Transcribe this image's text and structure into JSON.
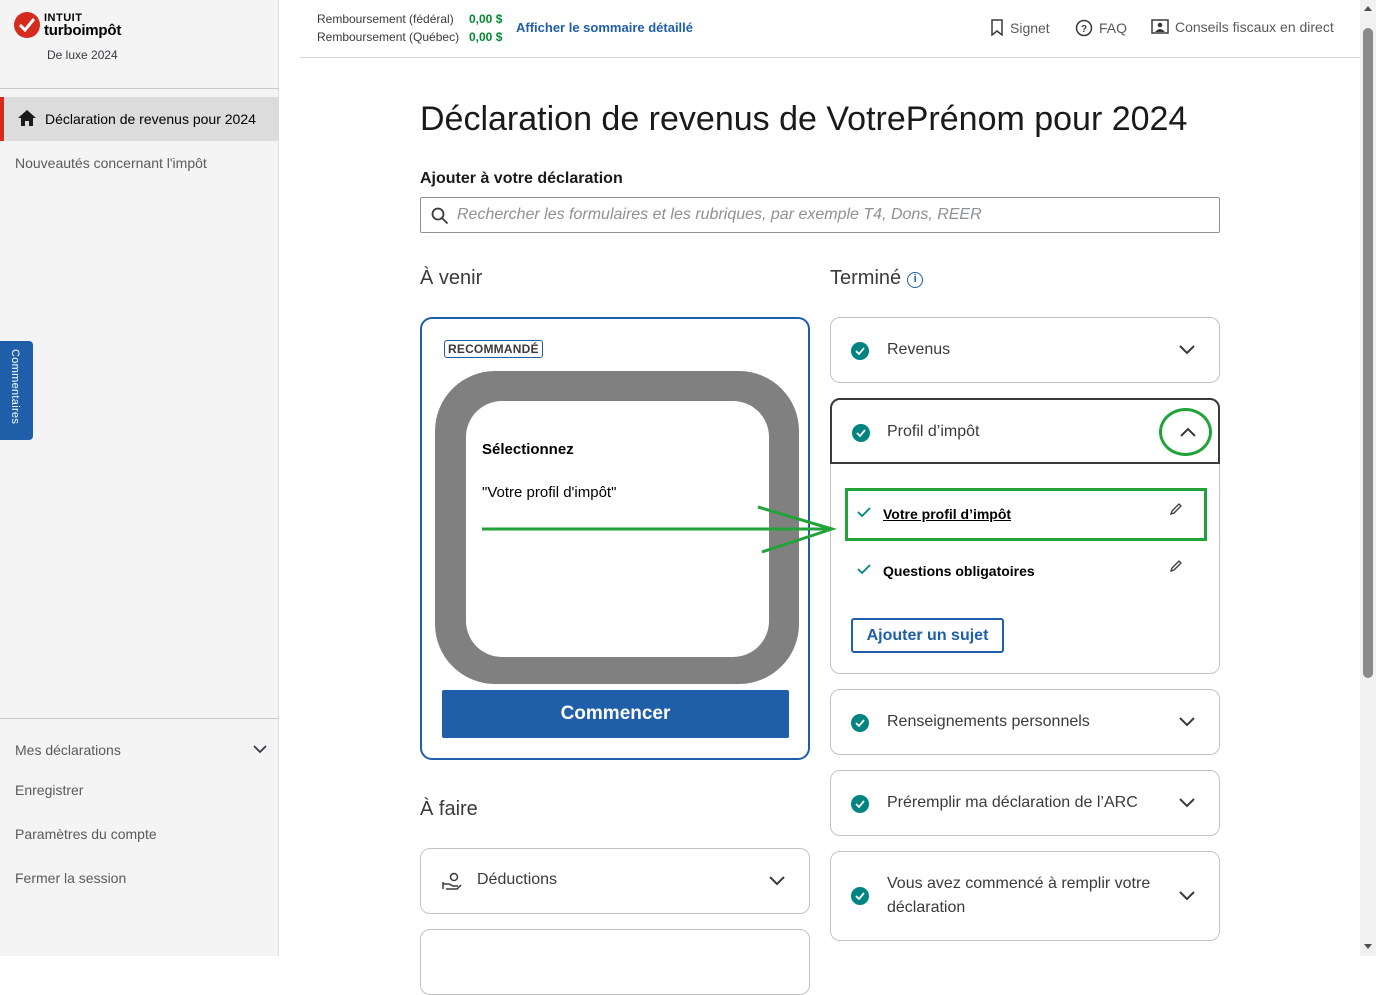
{
  "brand": {
    "intuit": "INTUIT",
    "product": "turboimpôt",
    "edition": "De luxe 2024"
  },
  "sidebar": {
    "active_item": "Déclaration de revenus pour 2024",
    "news_item": "Nouveautés concernant l'impôt",
    "bottom_items": [
      "Mes déclarations",
      "Enregistrer",
      "Paramètres du compte",
      "Fermer la session"
    ],
    "feedback_tab": "Commentaires"
  },
  "header": {
    "refund_federal_label": "Remboursement (fédéral)",
    "refund_federal_value": "0,00  $",
    "refund_quebec_label": "Remboursement (Québec)",
    "refund_quebec_value": "0,00  $",
    "summary_link": "Afficher le sommaire détaillé",
    "bookmark": "Signet",
    "faq": "FAQ",
    "live_advice": "Conseils fiscaux en direct"
  },
  "main": {
    "title": "Déclaration de revenus de VotrePrénom pour 2024",
    "add_label": "Ajouter à votre déclaration",
    "search_placeholder": "Rechercher les formulaires et les rubriques, par exemple T4, Dons, REER",
    "upcoming_heading": "À venir",
    "done_heading": "Terminé",
    "todo_heading": "À faire"
  },
  "recommended_card": {
    "badge": "RECOMMANDÉ",
    "line1": "Sélectionnez",
    "line2": "\"Votre profil d'impôt\"",
    "button": "Commencer"
  },
  "done_sections": [
    {
      "label": "Revenus",
      "expanded": false
    },
    {
      "label": "Profil d’impôt",
      "expanded": true,
      "items": [
        "Votre profil d’impôt",
        "Questions obligatoires"
      ],
      "add_button": "Ajouter un sujet"
    },
    {
      "label": "Renseignements personnels",
      "expanded": false
    },
    {
      "label": "Préremplir ma déclaration de l’ARC",
      "expanded": false
    },
    {
      "label": "Vous avez commencé à remplir votre déclaration",
      "expanded": false
    }
  ],
  "todo_sections": [
    {
      "label": "Déductions"
    }
  ],
  "colors": {
    "accent": "#1f5ea8",
    "check": "#008481",
    "brand_red": "#d52b1e",
    "annotation": "#22a33a",
    "refund": "#00892f"
  }
}
